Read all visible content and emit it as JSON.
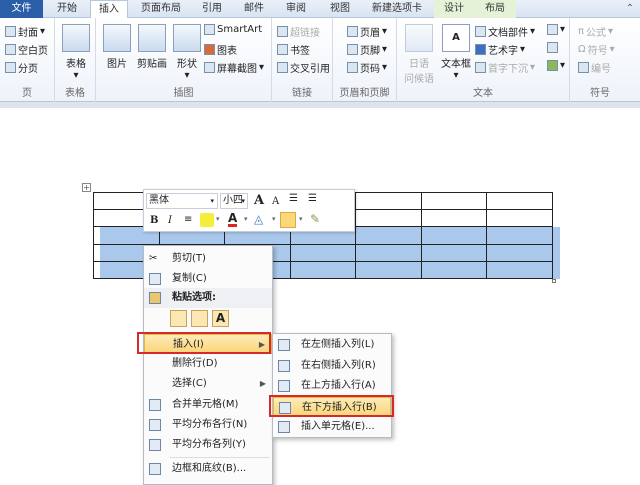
{
  "tabs": [
    "文件",
    "开始",
    "插入",
    "页面布局",
    "引用",
    "邮件",
    "审阅",
    "视图",
    "新建选项卡",
    "设计",
    "布局"
  ],
  "ribbon": {
    "page": {
      "label": "页",
      "items": [
        "封面",
        "空白页",
        "分页"
      ]
    },
    "table": {
      "label": "表格",
      "button": "表格"
    },
    "illus": {
      "label": "插图",
      "items": [
        "图片",
        "剪贴画",
        "形状"
      ],
      "small": [
        "SmartArt",
        "图表",
        "屏幕截图"
      ]
    },
    "links": {
      "label": "链接",
      "items": [
        "超链接",
        "书签",
        "交叉引用"
      ]
    },
    "hf": {
      "label": "页眉和页脚",
      "items": [
        "页眉",
        "页脚",
        "页码"
      ]
    },
    "text": {
      "label": "文本",
      "japanese": [
        "日语",
        "问候语"
      ],
      "textbox": "文本框",
      "items": [
        "文档部件",
        "艺术字",
        "首字下沉"
      ]
    },
    "symbols": {
      "label": "符号",
      "items": [
        "公式",
        "符号",
        "编号"
      ]
    }
  },
  "mini_toolbar": {
    "font": "黑体",
    "size": "小四",
    "bold": "B",
    "italic": "I",
    "grow": "A",
    "shrink": "A",
    "font_color": "A"
  },
  "context_menu": {
    "items": [
      "剪切(T)",
      "复制(C)",
      "粘贴选项:",
      "插入(I)",
      "删除行(D)",
      "选择(C)",
      "合并单元格(M)",
      "平均分布各行(N)",
      "平均分布各列(Y)",
      "边框和底纹(B)..."
    ],
    "paste_text_icon": "A"
  },
  "submenu": {
    "items": [
      "在左侧插入列(L)",
      "在右侧插入列(R)",
      "在上方插入行(A)",
      "在下方插入行(B)",
      "插入单元格(E)..."
    ]
  },
  "colors": {
    "selection": "#a9c8ec",
    "highlight_box": "#d62a2a",
    "file_tab": "#2b5ea8"
  }
}
